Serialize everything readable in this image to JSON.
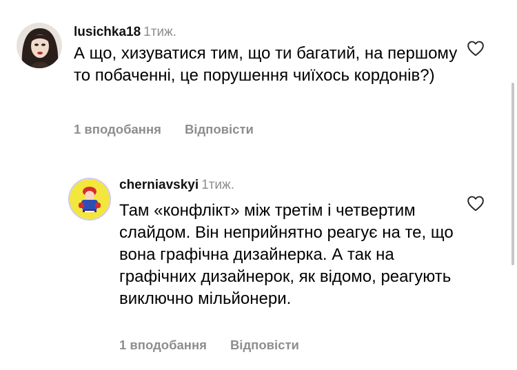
{
  "comments": [
    {
      "username": "lusichka18",
      "time": "1тиж.",
      "text": "А що, хизуватися тим, що ти багатий, на першому то побаченні, це порушення чиїхось кордонів?)",
      "likes_label": "1 вподобання",
      "reply_label": "Відповісти",
      "avatar_icon": "user-photo-avatar",
      "like_icon": "heart-outline-icon"
    },
    {
      "username": "cherniavskyi",
      "time": "1тиж.",
      "text": "Там «конфлікт» між третім і четвертим слайдом. Він неприйнятно реагує на те, що вона графічна дизайнерка. А так на графічних дизайнерок, як відомо, реагують виключно мільйонери.",
      "likes_label": "1 вподобання",
      "reply_label": "Відповісти",
      "avatar_icon": "illustrated-avatar",
      "like_icon": "heart-outline-icon"
    }
  ],
  "colors": {
    "secondary_text": "#8e8e8e",
    "primary_text": "#000000",
    "avatar_ring": "#d0c9ea"
  }
}
